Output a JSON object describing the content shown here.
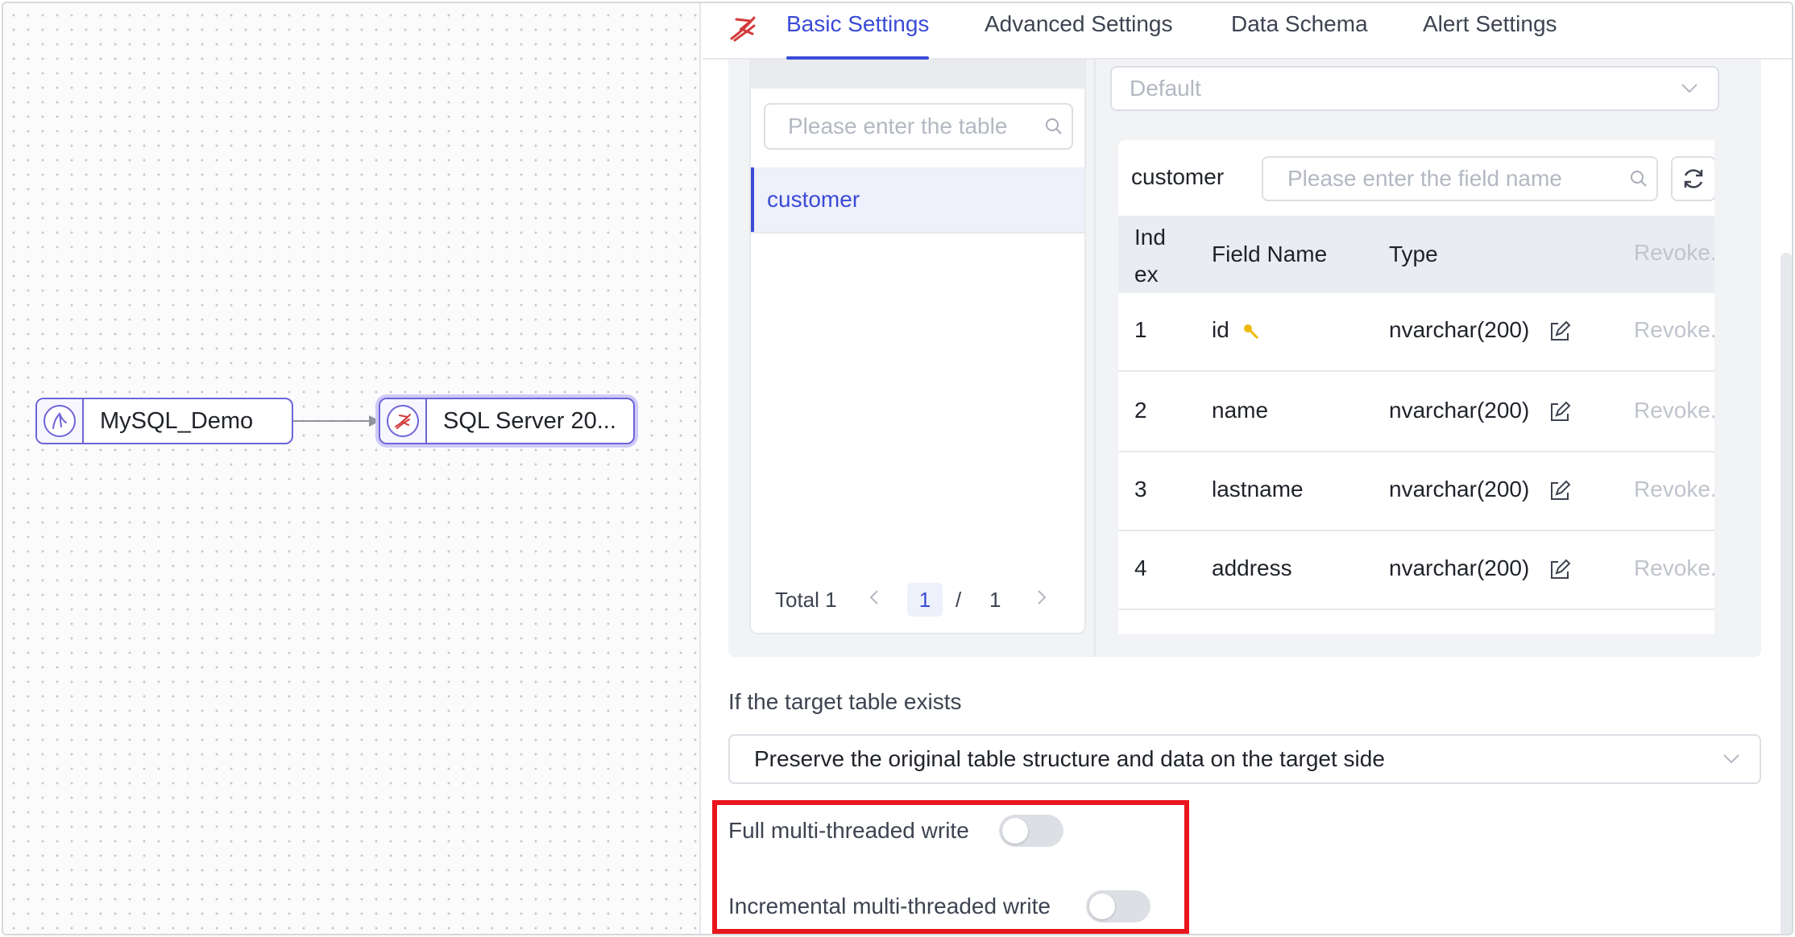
{
  "canvas": {
    "nodes": [
      {
        "label": "MySQL_Demo",
        "icon": "mysql-icon"
      },
      {
        "label": "SQL Server 20...",
        "icon": "sqlserver-icon"
      }
    ]
  },
  "tabs": [
    {
      "label": "Basic Settings",
      "active": true
    },
    {
      "label": "Advanced Settings",
      "active": false
    },
    {
      "label": "Data Schema",
      "active": false
    },
    {
      "label": "Alert Settings",
      "active": false
    }
  ],
  "schema": {
    "default_select": "Default",
    "table_search_placeholder": "Please enter the table",
    "tables": [
      "customer"
    ],
    "pager": {
      "total": "Total 1",
      "current": "1",
      "sep": "/",
      "pages": "1"
    },
    "selected_table": "customer",
    "field_search_placeholder": "Please enter the field name",
    "columns": {
      "index": [
        "Ind",
        "ex"
      ],
      "field": "Field Name",
      "type": "Type",
      "action": "Revoke."
    },
    "rows": [
      {
        "index": "1",
        "field": "id",
        "type": "nvarchar(200)",
        "action": "Revoke.",
        "primary_key": true
      },
      {
        "index": "2",
        "field": "name",
        "type": "nvarchar(200)",
        "action": "Revoke.",
        "primary_key": false
      },
      {
        "index": "3",
        "field": "lastname",
        "type": "nvarchar(200)",
        "action": "Revoke.",
        "primary_key": false
      },
      {
        "index": "4",
        "field": "address",
        "type": "nvarchar(200)",
        "action": "Revoke.",
        "primary_key": false
      }
    ]
  },
  "target_exists": {
    "label": "If the target table exists",
    "value": "Preserve the original table structure and data on the target side"
  },
  "toggles": [
    {
      "label": "Full multi-threaded write",
      "on": false
    },
    {
      "label": "Incremental multi-threaded write",
      "on": false
    }
  ],
  "colors": {
    "accent": "#3a4bd6",
    "node_border": "#6e64d8",
    "highlight": "#e8161c"
  }
}
